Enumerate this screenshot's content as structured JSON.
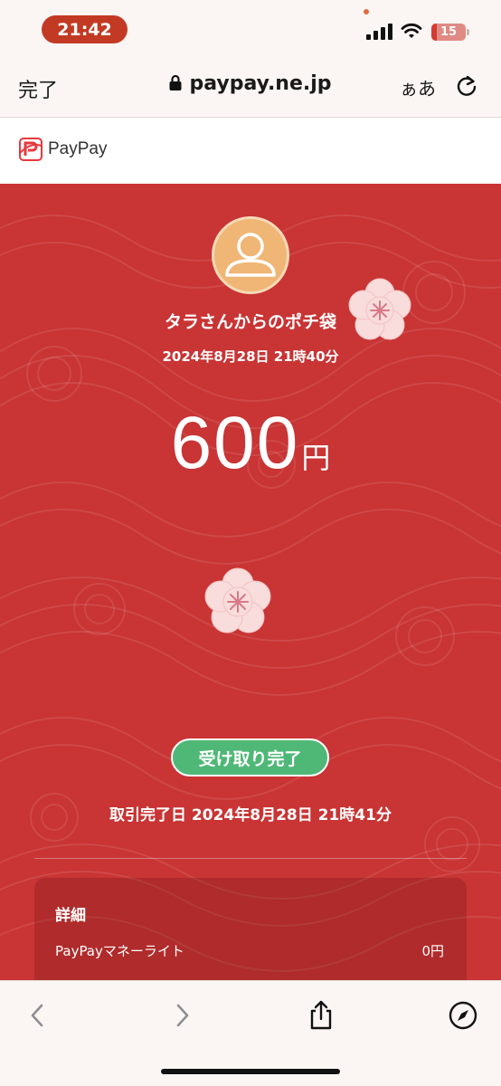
{
  "status_bar": {
    "time": "21:42",
    "battery_level": "15",
    "battery_fraction": 0.15
  },
  "browser": {
    "done_label": "完了",
    "url": "paypay.ne.jp",
    "text_size_label": "ぁあ"
  },
  "brand": {
    "name": "PayPay",
    "logo_color": "#e8383d"
  },
  "gift": {
    "sender_title": "タラさんからのポチ袋",
    "sent_datetime": "2024年8月28日 21時40分",
    "amount_value": "600",
    "amount_unit": "円",
    "status": "受け取り完了",
    "completed_label": "取引完了日 2024年8月28日 21時41分"
  },
  "details": {
    "title": "詳細",
    "rows": [
      {
        "label": "PayPayマネーライト",
        "value": "0円"
      }
    ]
  },
  "colors": {
    "background_red": "#c93434",
    "status_green": "#4fb877",
    "avatar_orange": "#efb675",
    "flower_pink": "#f9dcdc"
  },
  "icons": {
    "back": "chevron-left-icon",
    "forward": "chevron-right-icon",
    "share": "share-icon",
    "compass": "compass-icon",
    "reload": "reload-icon",
    "lock": "lock-icon"
  }
}
